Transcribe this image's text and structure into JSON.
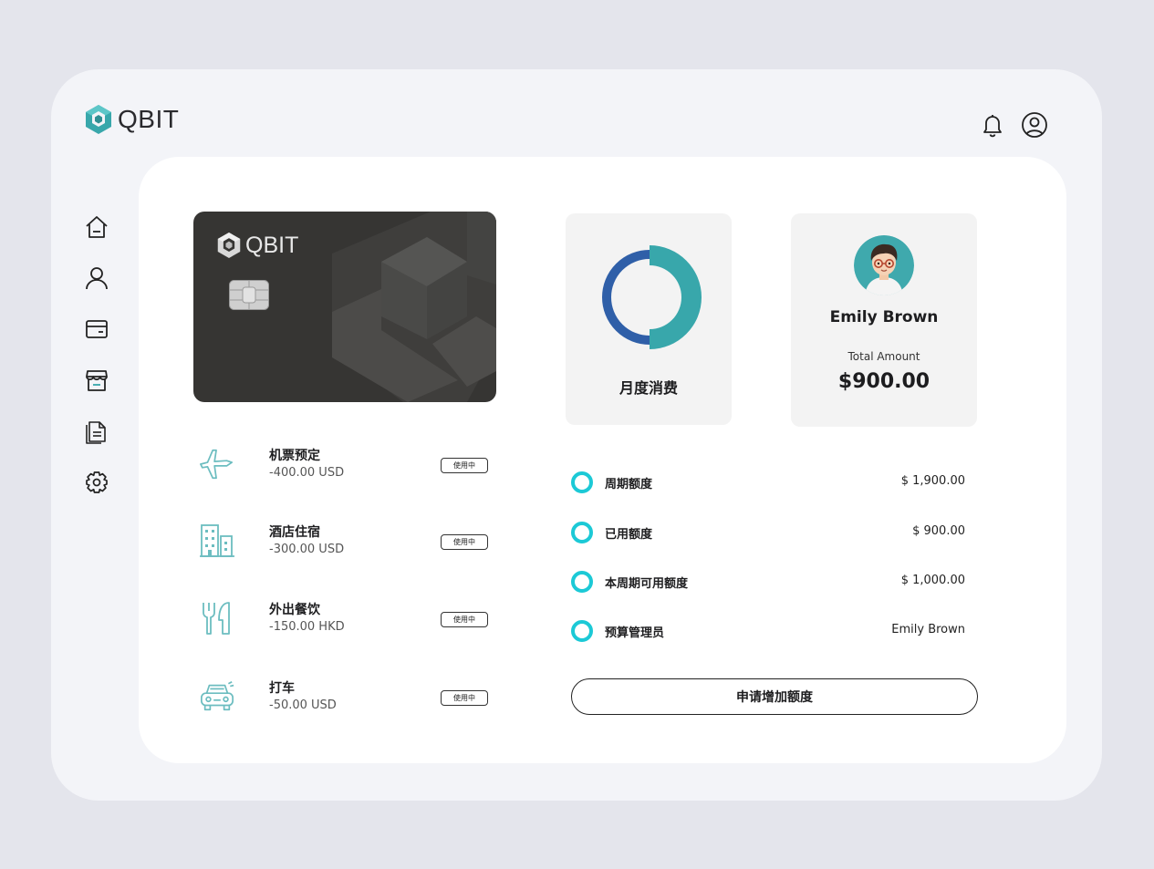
{
  "brand": {
    "name": "QBIT",
    "card_name": "QBIT"
  },
  "colors": {
    "accent": "#38a7ab",
    "accent_dark": "#2f5fa8",
    "ring": "#1cc9d6",
    "card": "#363533"
  },
  "header_icons": [
    "bell-icon",
    "user-circle-icon"
  ],
  "sidebar": [
    "home-icon",
    "user-icon",
    "wallet-icon",
    "store-icon",
    "document-icon",
    "gear-icon"
  ],
  "transactions": [
    {
      "icon": "airplane-icon",
      "name": "机票预定",
      "amount": "-400.00 USD",
      "status": "使用中"
    },
    {
      "icon": "hotel-icon",
      "name": "酒店住宿",
      "amount": "-300.00 USD",
      "status": "使用中"
    },
    {
      "icon": "dining-icon",
      "name": "外出餐饮",
      "amount": "-150.00 HKD",
      "status": "使用中"
    },
    {
      "icon": "taxi-icon",
      "name": "打车",
      "amount": "-50.00 USD",
      "status": "使用中"
    }
  ],
  "monthly": {
    "label": "月度消费",
    "used_fraction": 0.5
  },
  "user": {
    "name": "Emily Brown",
    "total_label": "Total Amount",
    "total_amount": "$900.00"
  },
  "quota": [
    {
      "label": "周期额度",
      "value": "$ 1,900.00"
    },
    {
      "label": "已用额度",
      "value": "$ 900.00"
    },
    {
      "label": "本周期可用额度",
      "value": "$ 1,000.00"
    },
    {
      "label": "预算管理员",
      "value": "Emily Brown"
    }
  ],
  "apply_button": "申请增加额度"
}
